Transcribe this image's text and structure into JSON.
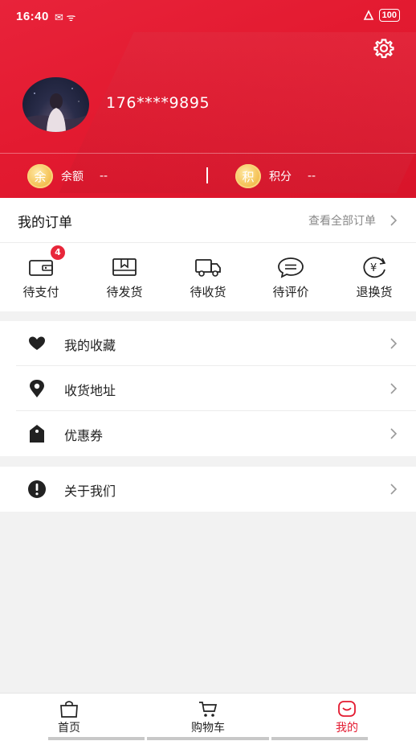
{
  "status_bar": {
    "time": "16:40",
    "left_icons": "✉ ᯤ",
    "battery": "100"
  },
  "profile": {
    "phone": "176****9895"
  },
  "stats": {
    "balance": {
      "coin_char": "余",
      "label": "余额",
      "value": "--"
    },
    "points": {
      "coin_char": "积",
      "label": "积分",
      "value": "--"
    }
  },
  "orders": {
    "title": "我的订单",
    "view_all": "查看全部订单",
    "items": [
      {
        "label": "待支付",
        "badge": "4",
        "icon": "wallet-icon"
      },
      {
        "label": "待发货",
        "icon": "package-icon"
      },
      {
        "label": "待收货",
        "icon": "truck-icon"
      },
      {
        "label": "待评价",
        "icon": "comment-icon"
      },
      {
        "label": "退换货",
        "icon": "yuan-refresh-icon"
      }
    ]
  },
  "menu": {
    "items": [
      {
        "label": "我的收藏",
        "icon": "heart-icon"
      },
      {
        "label": "收货地址",
        "icon": "location-pin-icon"
      },
      {
        "label": "优惠券",
        "icon": "coupon-tag-icon"
      }
    ],
    "about": {
      "label": "关于我们",
      "icon": "exclamation-icon"
    }
  },
  "tabbar": {
    "items": [
      {
        "label": "首页",
        "icon": "shopping-bag-icon"
      },
      {
        "label": "购物车",
        "icon": "cart-icon"
      },
      {
        "label": "我的",
        "icon": "profile-icon",
        "active": true
      }
    ]
  },
  "colors": {
    "brand_red": "#e31a30",
    "coin_gold": "#f4c256",
    "badge_red": "#e8263a"
  }
}
